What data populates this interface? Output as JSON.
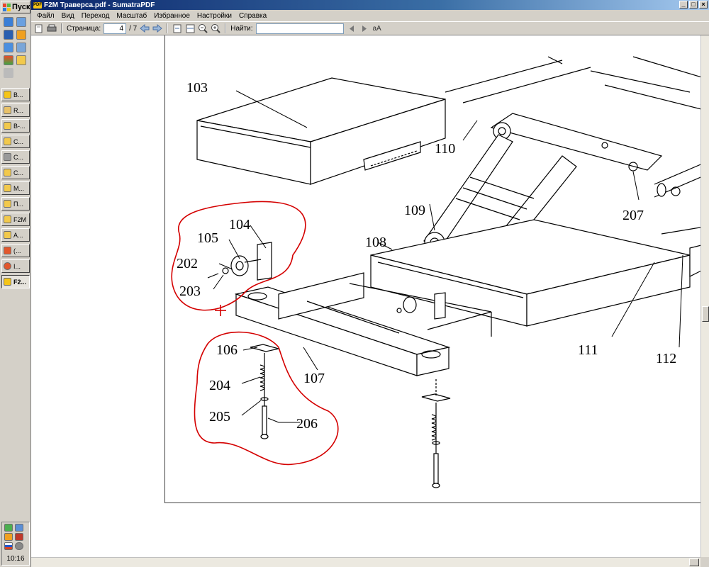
{
  "start_button": {
    "label": "Пуск"
  },
  "taskbar": {
    "buttons": [
      {
        "label": "В...",
        "active": false
      },
      {
        "label": "R...",
        "active": false
      },
      {
        "label": "В-...",
        "active": false
      },
      {
        "label": "С...",
        "active": false
      },
      {
        "label": "С...",
        "active": false
      },
      {
        "label": "С...",
        "active": false
      },
      {
        "label": "М...",
        "active": false
      },
      {
        "label": "П...",
        "active": false
      },
      {
        "label": "F2M",
        "active": false
      },
      {
        "label": "А...",
        "active": false
      },
      {
        "label": "(...",
        "active": false
      },
      {
        "label": "I...",
        "active": false
      },
      {
        "label": "F2...",
        "active": true
      }
    ],
    "clock": "10:16"
  },
  "window": {
    "title": "F2M Траверса.pdf - SumatraPDF",
    "app_badge": "PDF",
    "controls": {
      "minimize": "_",
      "maximize": "□",
      "close": "×"
    }
  },
  "menu": [
    "Файл",
    "Вид",
    "Переход",
    "Масштаб",
    "Избранное",
    "Настройки",
    "Справка"
  ],
  "toolbar": {
    "page_label": "Страница:",
    "page_value": "4",
    "page_total": "/ 7",
    "find_label": "Найти:",
    "find_value": "",
    "match_case": "aA"
  },
  "drawing": {
    "labels": {
      "l103": "103",
      "l110": "110",
      "l109": "109",
      "l108": "108",
      "l207": "207",
      "l104": "104",
      "l105": "105",
      "l202": "202",
      "l203": "203",
      "l106": "106",
      "l107": "107",
      "l204": "204",
      "l205": "205",
      "l206": "206",
      "l111": "111",
      "l112": "112"
    },
    "markup_color": "#d40000"
  }
}
